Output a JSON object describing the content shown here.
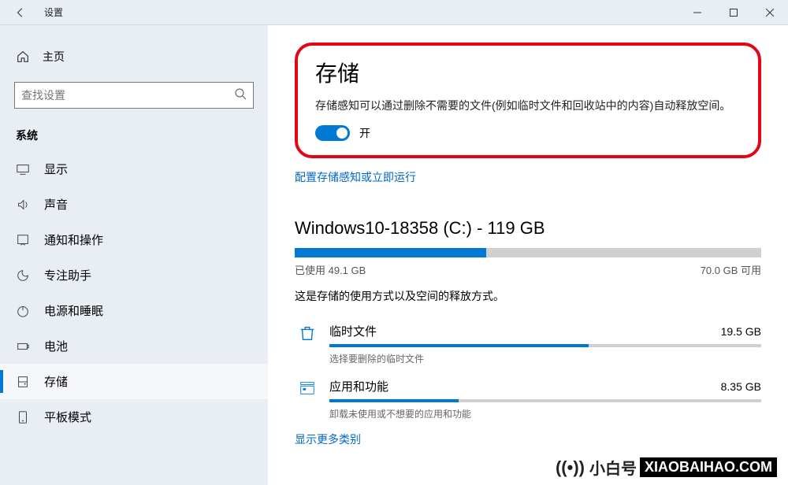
{
  "titlebar": {
    "title": "设置"
  },
  "sidebar": {
    "home": "主页",
    "searchPlaceholder": "查找设置",
    "section": "系统",
    "items": [
      {
        "label": "显示"
      },
      {
        "label": "声音"
      },
      {
        "label": "通知和操作"
      },
      {
        "label": "专注助手"
      },
      {
        "label": "电源和睡眠"
      },
      {
        "label": "电池"
      },
      {
        "label": "存储",
        "active": true
      },
      {
        "label": "平板模式"
      }
    ]
  },
  "content": {
    "pageTitle": "存储",
    "description": "存储感知可以通过删除不需要的文件(例如临时文件和回收站中的内容)自动释放空间。",
    "toggleLabel": "开",
    "configLink": "配置存储感知或立即运行",
    "driveTitle": "Windows10-18358 (C:) - 119 GB",
    "usedLabel": "已使用 49.1 GB",
    "freeLabel": "70.0 GB 可用",
    "usedPercent": 41,
    "storageDesc": "这是存储的使用方式以及空间的释放方式。",
    "categories": [
      {
        "name": "临时文件",
        "size": "19.5 GB",
        "percent": 60,
        "sub": "选择要删除的临时文件"
      },
      {
        "name": "应用和功能",
        "size": "8.35 GB",
        "percent": 30,
        "sub": "卸载未使用或不想要的应用和功能"
      }
    ],
    "moreLink": "显示更多类别"
  },
  "watermark": {
    "brand": "小白号",
    "domain": "XIAOBAIHAO.COM"
  }
}
